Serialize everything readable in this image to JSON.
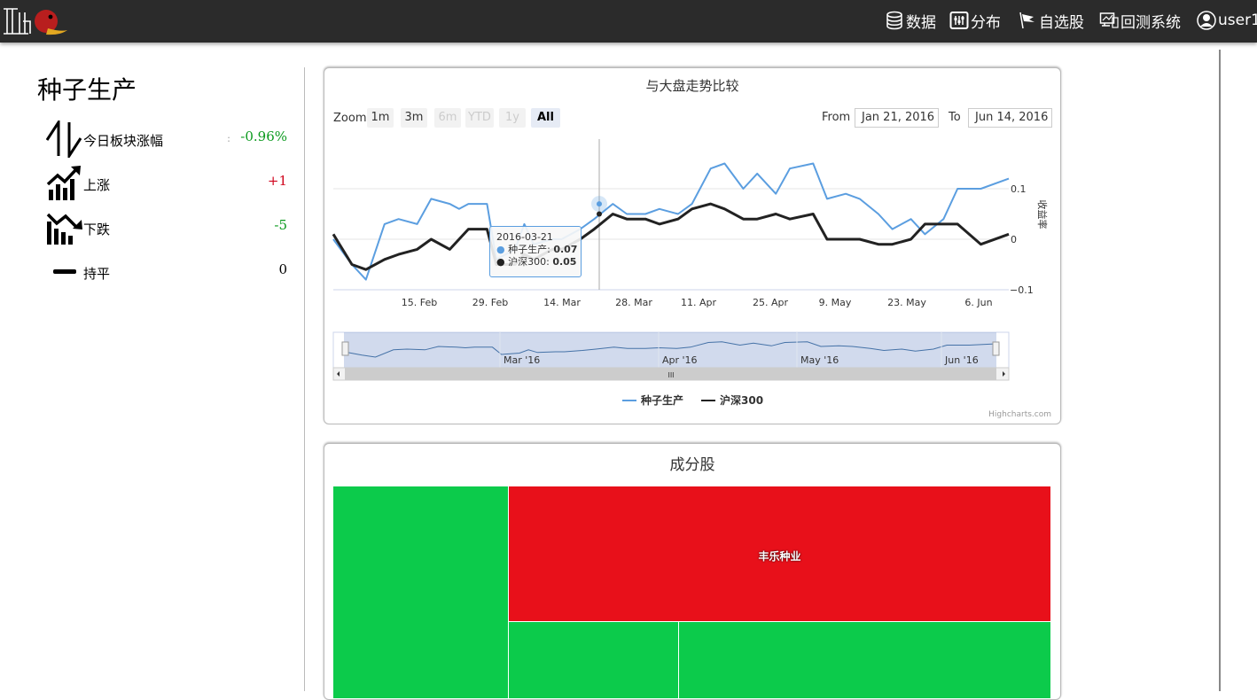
{
  "nav": {
    "items": [
      {
        "label": "数据",
        "icon": "database-icon"
      },
      {
        "label": "分布",
        "icon": "distribution-icon"
      },
      {
        "label": "自选股",
        "icon": "flag-icon"
      },
      {
        "label": "回测系统",
        "icon": "monitor-icon"
      },
      {
        "label": "user1",
        "icon": "user-icon"
      }
    ]
  },
  "sector": {
    "title": "种子生产",
    "stats": [
      {
        "label": "今日板块涨幅",
        "value": "-0.96%",
        "color": "#0b9a1e",
        "icon": "up-down-arrows-icon"
      },
      {
        "label": "上涨",
        "value": "+1",
        "color": "#d0021b",
        "icon": "rising-chart-icon"
      },
      {
        "label": "下跌",
        "value": "-5",
        "color": "#0b9a1e",
        "icon": "falling-chart-icon"
      },
      {
        "label": "持平",
        "value": "0",
        "color": "#000000",
        "icon": "flat-line-icon"
      }
    ],
    "colon": ":"
  },
  "comparison": {
    "title": "与大盘走势比较",
    "zoom_label": "Zoom",
    "zoom_buttons": [
      "1m",
      "3m",
      "6m",
      "YTD",
      "1y",
      "All"
    ],
    "from_label": "From",
    "from_value": "Jan 21, 2016",
    "to_label": "To",
    "to_value": "Jun 14, 2016",
    "credits": "Highcharts.com",
    "tooltip": {
      "date": "2016-03-21",
      "rows": [
        {
          "name": "种子生产",
          "value": "0.07"
        },
        {
          "name": "沪深300",
          "value": "0.05"
        }
      ]
    },
    "navigator_labels": [
      "Mar '16",
      "Apr '16",
      "May '16",
      "Jun '16"
    ],
    "scroll_grip": "III"
  },
  "chart_data": {
    "type": "line",
    "title": "与大盘走势比较",
    "ylabel": "收益率",
    "ylim": [
      -0.1,
      0.15
    ],
    "yticks": [
      "0.1",
      "0",
      "−0.1"
    ],
    "xticks": [
      "15. Feb",
      "29. Feb",
      "14. Mar",
      "28. Mar",
      "11. Apr",
      "25. Apr",
      "9. May",
      "23. May",
      "6. Jun"
    ],
    "legend_position": "bottom",
    "series": [
      {
        "name": "种子生产",
        "color": "#5b9ee0",
        "x": [
          "2016-01-21",
          "2016-01-25",
          "2016-01-28",
          "2016-02-01",
          "2016-02-04",
          "2016-02-08",
          "2016-02-11",
          "2016-02-15",
          "2016-02-17",
          "2016-02-19",
          "2016-02-23",
          "2016-02-25",
          "2016-02-29",
          "2016-03-02",
          "2016-03-04",
          "2016-03-08",
          "2016-03-10",
          "2016-03-14",
          "2016-03-17",
          "2016-03-21",
          "2016-03-24",
          "2016-03-28",
          "2016-03-31",
          "2016-04-04",
          "2016-04-07",
          "2016-04-11",
          "2016-04-14",
          "2016-04-18",
          "2016-04-21",
          "2016-04-25",
          "2016-04-28",
          "2016-05-03",
          "2016-05-06",
          "2016-05-10",
          "2016-05-13",
          "2016-05-17",
          "2016-05-20",
          "2016-05-24",
          "2016-05-27",
          "2016-05-31",
          "2016-06-03",
          "2016-06-08",
          "2016-06-14"
        ],
        "values": [
          0.0,
          -0.05,
          -0.08,
          0.03,
          0.04,
          0.03,
          0.08,
          0.07,
          0.06,
          0.07,
          0.07,
          -0.04,
          -0.02,
          0.03,
          -0.01,
          0.0,
          0.0,
          0.02,
          0.04,
          0.07,
          0.05,
          0.05,
          0.06,
          0.05,
          0.07,
          0.14,
          0.15,
          0.1,
          0.13,
          0.09,
          0.14,
          0.15,
          0.08,
          0.09,
          0.08,
          0.05,
          0.02,
          0.04,
          0.01,
          0.04,
          0.1,
          0.1,
          0.12
        ]
      },
      {
        "name": "沪深300",
        "color": "#222222",
        "x": [
          "2016-01-21",
          "2016-01-25",
          "2016-01-28",
          "2016-02-01",
          "2016-02-04",
          "2016-02-08",
          "2016-02-11",
          "2016-02-15",
          "2016-02-17",
          "2016-02-19",
          "2016-02-23",
          "2016-02-25",
          "2016-02-29",
          "2016-03-02",
          "2016-03-04",
          "2016-03-08",
          "2016-03-10",
          "2016-03-14",
          "2016-03-17",
          "2016-03-21",
          "2016-03-24",
          "2016-03-28",
          "2016-03-31",
          "2016-04-04",
          "2016-04-07",
          "2016-04-11",
          "2016-04-14",
          "2016-04-18",
          "2016-04-21",
          "2016-04-25",
          "2016-04-28",
          "2016-05-03",
          "2016-05-06",
          "2016-05-10",
          "2016-05-13",
          "2016-05-17",
          "2016-05-20",
          "2016-05-24",
          "2016-05-27",
          "2016-05-31",
          "2016-06-03",
          "2016-06-08",
          "2016-06-14"
        ],
        "values": [
          0.01,
          -0.05,
          -0.06,
          -0.04,
          -0.03,
          -0.02,
          0.0,
          -0.02,
          0.0,
          0.02,
          0.02,
          -0.05,
          -0.05,
          -0.03,
          -0.04,
          -0.02,
          -0.02,
          0.0,
          0.02,
          0.05,
          0.04,
          0.04,
          0.03,
          0.04,
          0.06,
          0.07,
          0.06,
          0.04,
          0.04,
          0.05,
          0.04,
          0.05,
          0.0,
          0.0,
          0.0,
          -0.01,
          -0.01,
          0.0,
          0.03,
          0.03,
          0.03,
          -0.01,
          0.01
        ]
      }
    ]
  },
  "components": {
    "title": "成分股",
    "label_fengle": "丰乐种业",
    "colors": {
      "up": "#e8101a",
      "down": "#0ccb4b"
    }
  }
}
